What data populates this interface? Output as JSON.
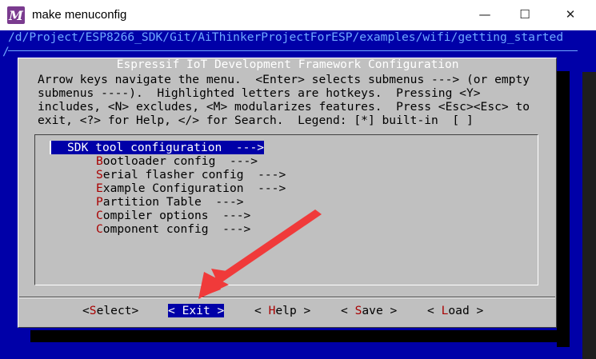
{
  "window": {
    "title": "make menuconfig",
    "app_icon_letter": "M",
    "minimize_glyph": "—",
    "maximize_glyph": "☐",
    "close_glyph": "✕"
  },
  "terminal": {
    "cwd_line": "/d/Project/ESP8266_SDK/Git/AiThinkerProjectForESP/examples/wifi/getting_started",
    "cwd_wrap": "/"
  },
  "dialog": {
    "title": " Espressif IoT Development Framework Configuration ",
    "help_lines": [
      "Arrow keys navigate the menu.  <Enter> selects submenus ---> (or empty",
      "submenus ----).  Highlighted letters are hotkeys.  Pressing <Y>",
      "includes, <N> excludes, <M> modularizes features.  Press <Esc><Esc> to",
      "exit, <?> for Help, </> for Search.  Legend: [*] built-in  [ ]"
    ],
    "menu_items": [
      {
        "hot": "S",
        "rest": "DK tool configuration  --->",
        "selected": true
      },
      {
        "hot": "B",
        "rest": "ootloader config  --->",
        "selected": false
      },
      {
        "hot": "S",
        "rest": "erial flasher config  --->",
        "selected": false
      },
      {
        "hot": "E",
        "rest": "xample Configuration  --->",
        "selected": false
      },
      {
        "hot": "P",
        "rest": "artition Table  --->",
        "selected": false
      },
      {
        "hot": "C",
        "rest": "ompiler options  --->",
        "selected": false
      },
      {
        "hot": "C",
        "rest": "omponent config  --->",
        "selected": false
      }
    ],
    "buttons": {
      "select": {
        "pre": "<",
        "hot": "S",
        "rest": "elect>"
      },
      "exit": {
        "pre": "< ",
        "hot": "E",
        "rest": "xit >"
      },
      "help": {
        "pre": "< ",
        "hot": "H",
        "rest": "elp >"
      },
      "save": {
        "pre": "< ",
        "hot": "S",
        "rest": "ave >"
      },
      "load": {
        "pre": "< ",
        "hot": "L",
        "rest": "oad >"
      }
    }
  },
  "colors": {
    "terminal_bg": "#0000a8",
    "dialog_bg": "#c0c0c0",
    "hotkey": "#a80000",
    "annotation_arrow": "#f03a3a"
  }
}
